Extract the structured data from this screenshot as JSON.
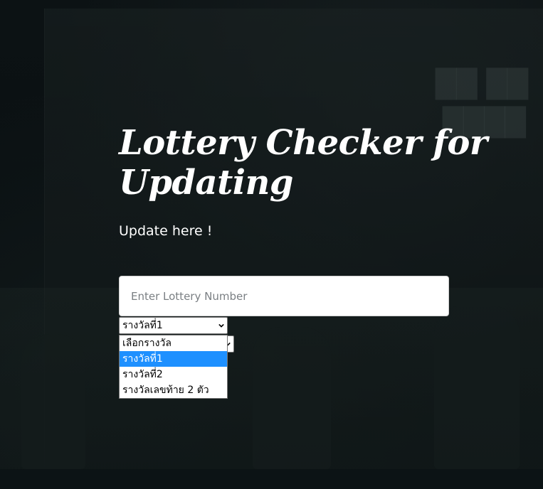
{
  "page": {
    "title": "Lottery Checker for Updating",
    "subtitle": "Update here !"
  },
  "form": {
    "lottery_input": {
      "placeholder": "Enter Lottery Number",
      "value": ""
    },
    "prize_select": {
      "selected": "รางวัลที่1",
      "options": [
        "เลือกรางวัล",
        "รางวัลที่1",
        "รางวัลที่2",
        "รางวัลเลขท้าย 2 ตัว"
      ],
      "highlighted_index": 1
    }
  },
  "icons": {
    "select_arrow": "chevron-down-icon"
  },
  "colors": {
    "background": "#0a0f11",
    "text": "#ffffff",
    "option_highlight": "#1e90ff"
  }
}
